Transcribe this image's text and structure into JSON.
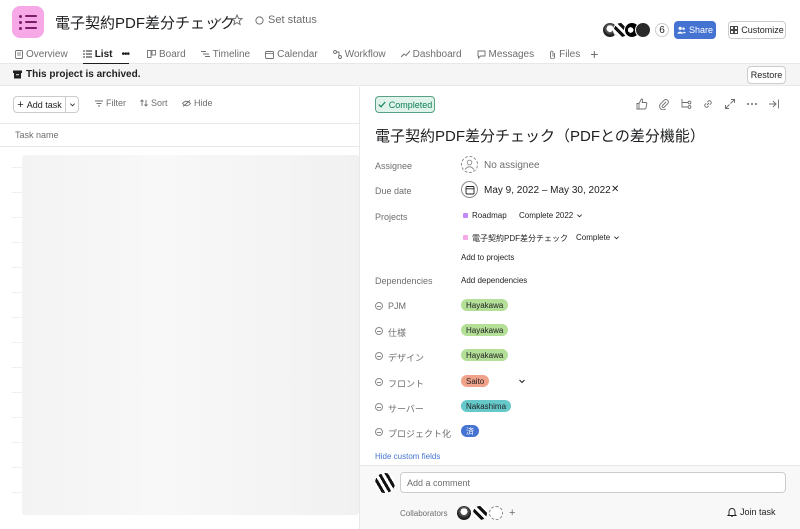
{
  "colors": {
    "accent": "#4573d2",
    "app_icon_bg": "#f7a8e6",
    "completed_green": "#0d7f56",
    "pill_green": "#b3df97",
    "pill_orange": "#f1a28a",
    "pill_teal": "#66c8c8",
    "pill_blue": "#4573d2"
  },
  "header": {
    "project_title": "電子契約PDF差分チェック",
    "set_status": "Set status",
    "member_count": "6",
    "share_label": "Share",
    "customize_label": "Customize"
  },
  "tabs": [
    {
      "label": "Overview",
      "icon": "overview-icon"
    },
    {
      "label": "List",
      "icon": "list-icon",
      "active": true
    },
    {
      "label": "Board",
      "icon": "board-icon"
    },
    {
      "label": "Timeline",
      "icon": "timeline-icon"
    },
    {
      "label": "Calendar",
      "icon": "calendar-icon"
    },
    {
      "label": "Workflow",
      "icon": "workflow-icon"
    },
    {
      "label": "Dashboard",
      "icon": "dashboard-icon"
    },
    {
      "label": "Messages",
      "icon": "messages-icon"
    },
    {
      "label": "Files",
      "icon": "files-icon"
    }
  ],
  "banner": {
    "text": "This project is archived.",
    "restore_label": "Restore"
  },
  "list": {
    "add_task": "Add task",
    "filter": "Filter",
    "sort": "Sort",
    "hide": "Hide",
    "column_task_name": "Task name"
  },
  "task": {
    "completed_label": "Completed",
    "title": "電子契約PDF差分チェック（PDFとの差分機能）",
    "assignee_label": "Assignee",
    "assignee_value": "No assignee",
    "due_date_label": "Due date",
    "due_date_value": "May 9, 2022 – May 30, 2022",
    "projects_label": "Projects",
    "projects": [
      {
        "name": "Roadmap",
        "section": "Complete 2022",
        "color": "#c58af9"
      },
      {
        "name": "電子契約PDF差分チェック",
        "section": "Complete",
        "color": "#f7a8e6"
      }
    ],
    "add_to_projects": "Add to projects",
    "dependencies_label": "Dependencies",
    "add_dependencies": "Add dependencies",
    "custom_fields": [
      {
        "label": "PJM",
        "value": "Hayakawa"
      },
      {
        "label": "仕様",
        "value": "Hayakawa"
      },
      {
        "label": "デザイン",
        "value": "Hayakawa"
      },
      {
        "label": "フロント",
        "value": "Saito"
      },
      {
        "label": "サーバー",
        "value": "Nakashima"
      },
      {
        "label": "プロジェクト化",
        "value": "済"
      }
    ],
    "hide_custom_fields": "Hide custom fields"
  },
  "comments": {
    "placeholder": "Add a comment",
    "collaborators_label": "Collaborators",
    "join_task": "Join task"
  }
}
